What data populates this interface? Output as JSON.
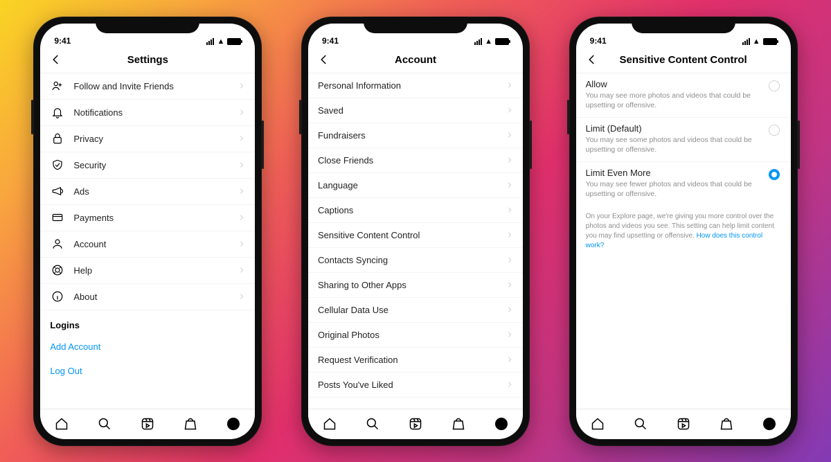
{
  "status": {
    "time": "9:41"
  },
  "phones": [
    {
      "title": "Settings",
      "items": [
        {
          "icon": "friends",
          "label": "Follow and Invite Friends"
        },
        {
          "icon": "bell",
          "label": "Notifications"
        },
        {
          "icon": "lock",
          "label": "Privacy"
        },
        {
          "icon": "shield",
          "label": "Security"
        },
        {
          "icon": "megaphone",
          "label": "Ads"
        },
        {
          "icon": "card",
          "label": "Payments"
        },
        {
          "icon": "user",
          "label": "Account"
        },
        {
          "icon": "lifebuoy",
          "label": "Help"
        },
        {
          "icon": "info",
          "label": "About"
        }
      ],
      "logins": {
        "heading": "Logins",
        "add": "Add Account",
        "logout": "Log Out"
      }
    },
    {
      "title": "Account",
      "items": [
        {
          "label": "Personal Information"
        },
        {
          "label": "Saved"
        },
        {
          "label": "Fundraisers"
        },
        {
          "label": "Close Friends"
        },
        {
          "label": "Language"
        },
        {
          "label": "Captions"
        },
        {
          "label": "Sensitive Content Control"
        },
        {
          "label": "Contacts Syncing"
        },
        {
          "label": "Sharing to Other Apps"
        },
        {
          "label": "Cellular Data Use"
        },
        {
          "label": "Original Photos"
        },
        {
          "label": "Request Verification"
        },
        {
          "label": "Posts You've Liked"
        }
      ]
    },
    {
      "title": "Sensitive Content Control",
      "options": [
        {
          "title": "Allow",
          "sub": "You may see more photos and videos that could be upsetting or offensive.",
          "selected": false
        },
        {
          "title": "Limit (Default)",
          "sub": "You may see some photos and videos that could be upsetting or offensive.",
          "selected": false
        },
        {
          "title": "Limit Even More",
          "sub": "You may see fewer photos and videos that could be upsetting or offensive.",
          "selected": true
        }
      ],
      "fineprint": "On your Explore page, we're giving you more control over the photos and videos you see. This setting can help limit content you may find upsetting or offensive.",
      "fineprint_link": "How does this control work?"
    }
  ]
}
